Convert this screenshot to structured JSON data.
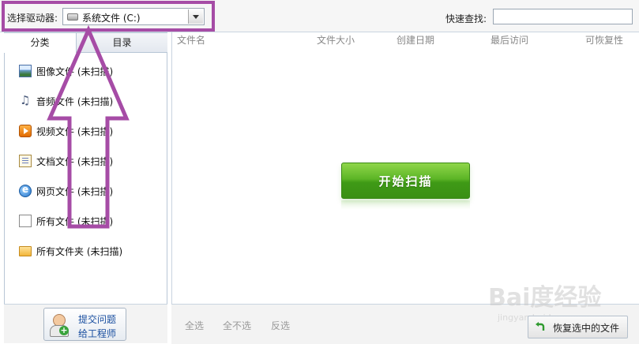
{
  "toolbar": {
    "drive_label": "选择驱动器:",
    "drive_value": "系统文件 (C:)",
    "search_label": "快速查找:",
    "search_value": ""
  },
  "left_panel": {
    "tabs": [
      "分类",
      "目录"
    ],
    "categories": [
      {
        "label": "图像文件 (未扫描)",
        "icon": "image-icon"
      },
      {
        "label": "音频文件 (未扫描)",
        "icon": "music-note-icon"
      },
      {
        "label": "视频文件 (未扫描)",
        "icon": "video-icon"
      },
      {
        "label": "文档文件 (未扫描)",
        "icon": "document-icon"
      },
      {
        "label": "网页文件 (未扫描)",
        "icon": "ie-browser-icon"
      },
      {
        "label": "所有文件 (未扫描)",
        "icon": "file-icon"
      },
      {
        "label": "所有文件夹 (未扫描)",
        "icon": "folder-icon"
      }
    ],
    "submit_button": {
      "line1": "提交问题",
      "line2": "给工程师"
    }
  },
  "main": {
    "columns": [
      "文件名",
      "文件大小",
      "创建日期",
      "最后访问",
      "可恢复性"
    ],
    "scan_button": "开始扫描",
    "footer": {
      "select_all": "全选",
      "select_none": "全不选",
      "invert": "反选",
      "restore_button": "恢复选中的文件"
    }
  },
  "watermark": {
    "main": "Bai度经验",
    "sub": "jingyan.baidu.com"
  },
  "colors": {
    "annotation": "#a64ca6",
    "scan_button": "#4ea61f"
  }
}
